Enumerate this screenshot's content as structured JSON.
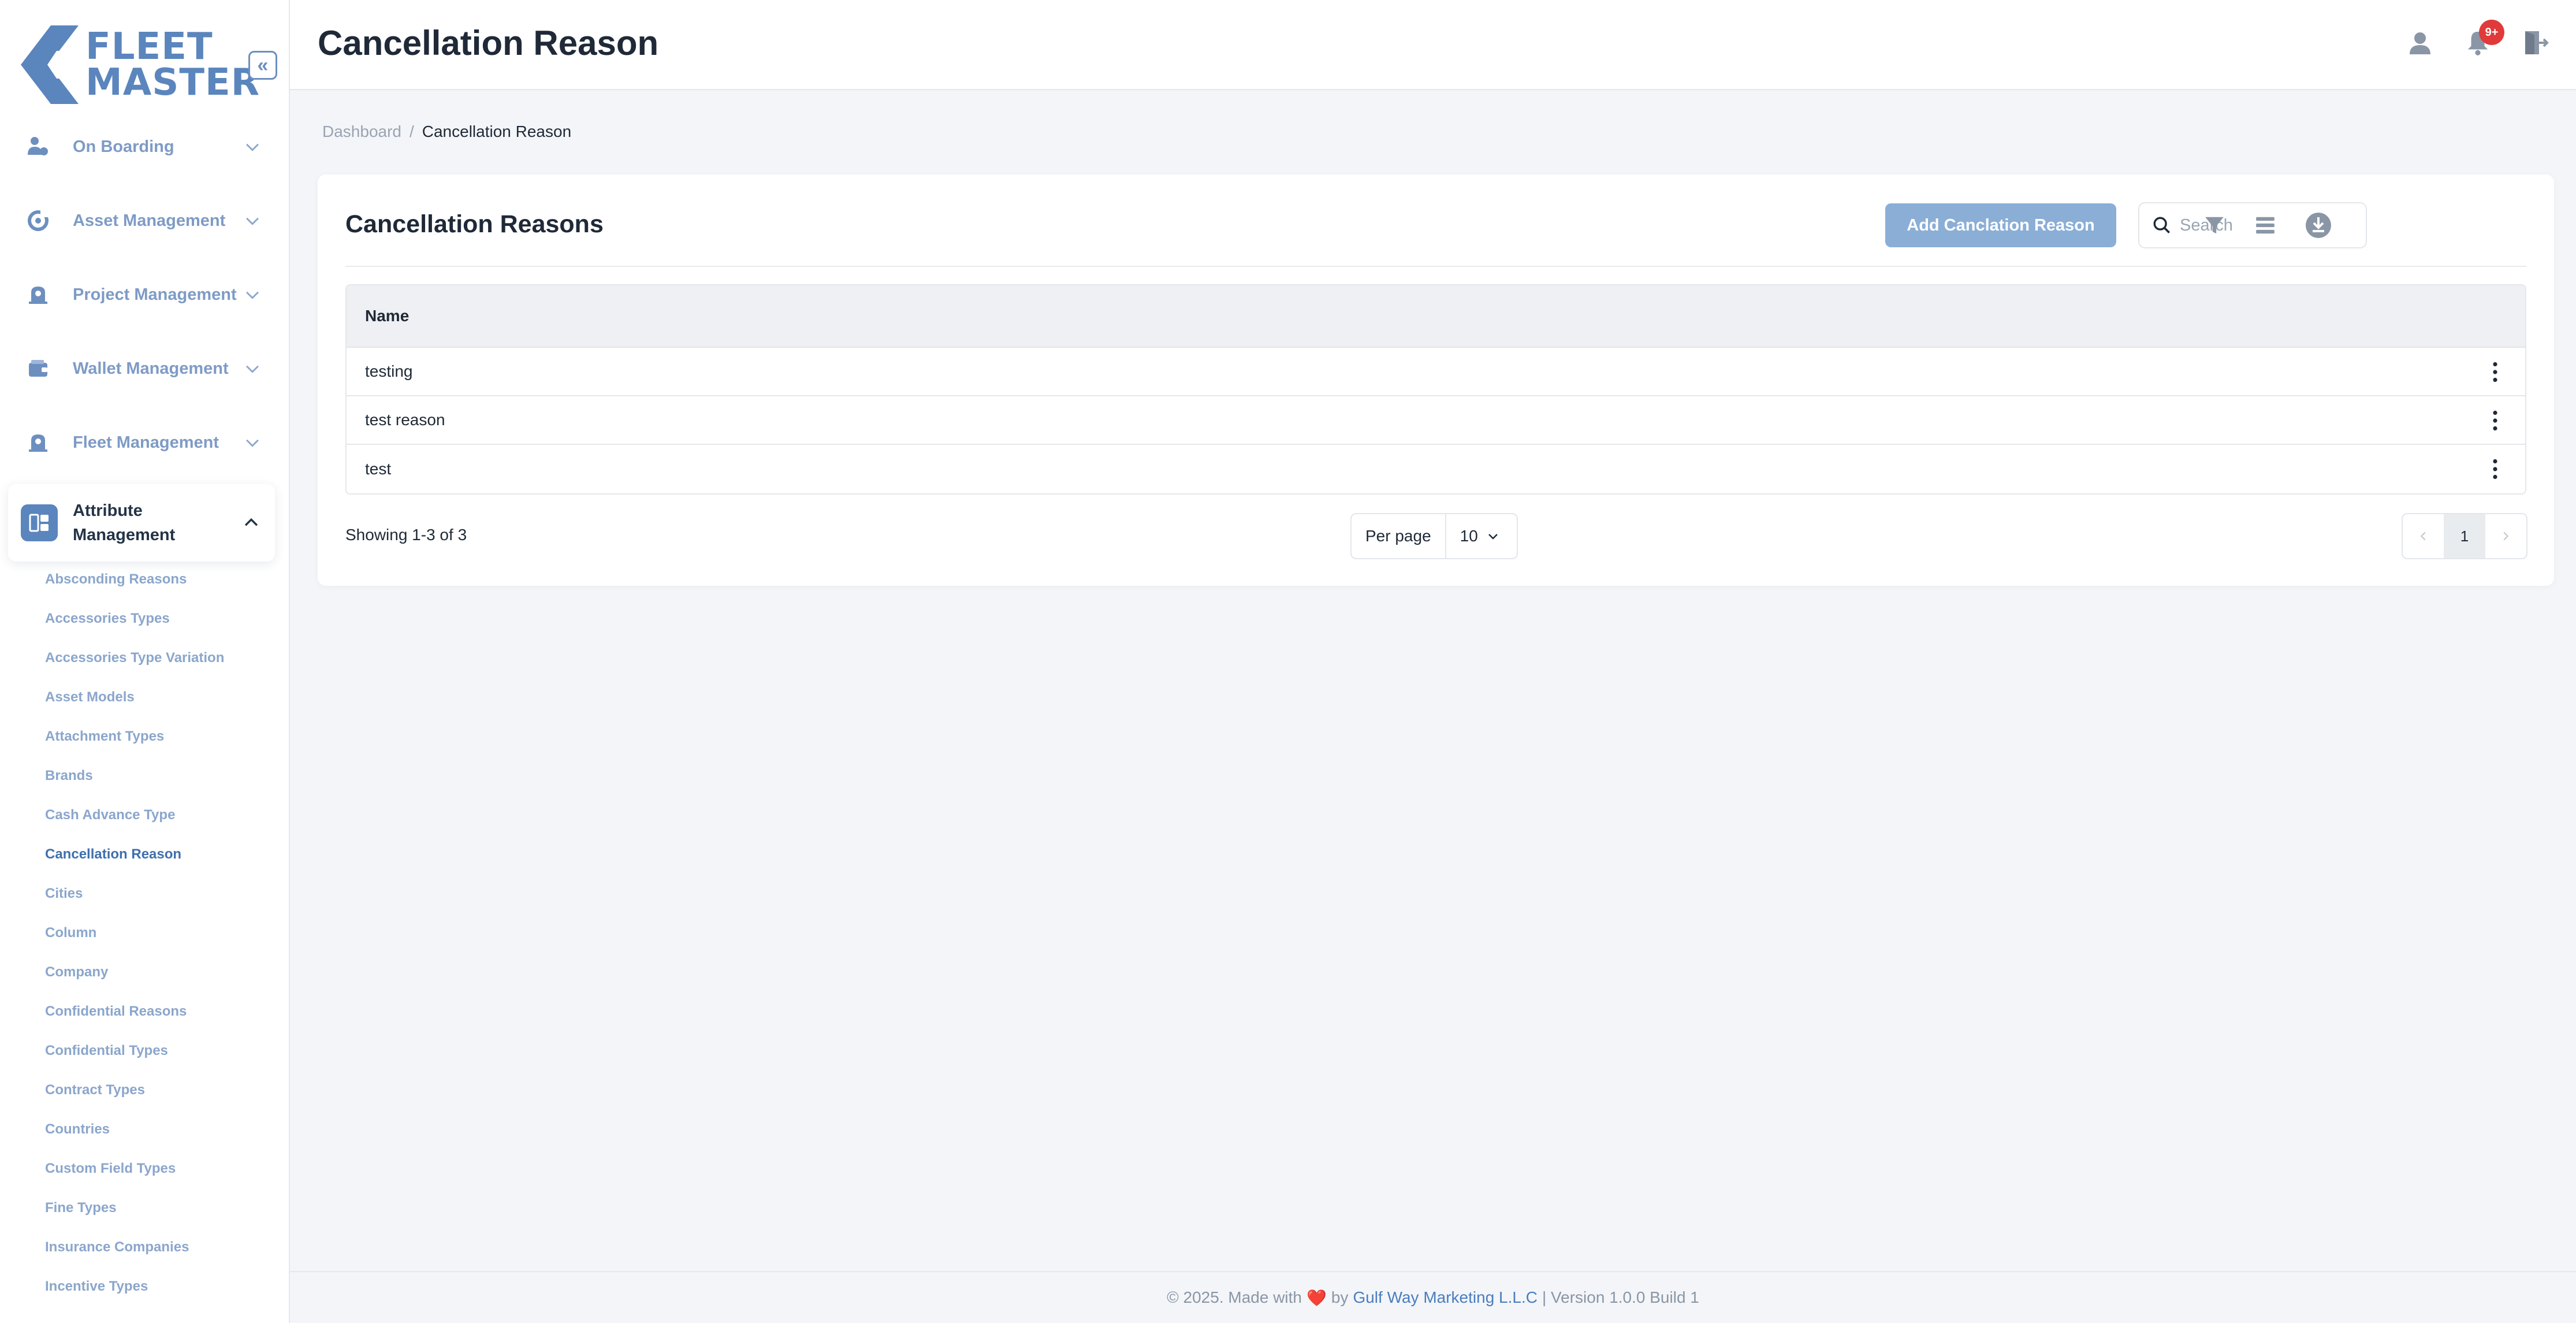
{
  "brand": {
    "line1": "FLEET",
    "line2": "MASTER",
    "color": "#5b85bd"
  },
  "sidebar": {
    "collapse_icon": "double-chevron-left-icon",
    "items": [
      {
        "label": "On Boarding",
        "icon": "onboarding-icon",
        "expanded": false
      },
      {
        "label": "Asset Management",
        "icon": "asset-icon",
        "expanded": false
      },
      {
        "label": "Project Management",
        "icon": "project-icon",
        "expanded": false
      },
      {
        "label": "Wallet Management",
        "icon": "wallet-icon",
        "expanded": false
      },
      {
        "label": "Fleet Management",
        "icon": "fleet-icon",
        "expanded": false
      },
      {
        "label_line1": "Attribute",
        "label_line2": "Management",
        "icon": "attribute-icon",
        "expanded": true
      }
    ],
    "subitems": [
      "Absconding Reasons",
      "Accessories Types",
      "Accessories Type Variation",
      "Asset Models",
      "Attachment Types",
      "Brands",
      "Cash Advance Type",
      "Cancellation Reason",
      "Cities",
      "Column",
      "Company",
      "Confidential Reasons",
      "Confidential Types",
      "Contract Types",
      "Countries",
      "Custom Field Types",
      "Fine Types",
      "Insurance Companies",
      "Incentive Types"
    ],
    "active_subitem": "Cancellation Reason"
  },
  "header": {
    "title": "Cancellation Reason",
    "notification_badge": "9+",
    "icons": [
      "user-icon",
      "bell-icon",
      "logout-icon"
    ]
  },
  "breadcrumb": {
    "home": "Dashboard",
    "separator": "/",
    "current": "Cancellation Reason"
  },
  "card": {
    "title": "Cancellation Reasons",
    "add_button": "Add Canclation Reason",
    "search_placeholder": "Search",
    "search_value": "",
    "tools": [
      "filter-icon",
      "columns-icon",
      "download-icon"
    ]
  },
  "table": {
    "columns": [
      "Name"
    ],
    "rows": [
      {
        "name": "testing"
      },
      {
        "name": "test reason"
      },
      {
        "name": "test"
      }
    ]
  },
  "pagination": {
    "showing": "Showing 1-3 of 3",
    "per_page_label": "Per page",
    "per_page_value": "10",
    "current_page": "1"
  },
  "footer": {
    "prefix": "© 2025. Made with",
    "heart": "❤️",
    "by": "by",
    "company": "Gulf Way Marketing L.L.C",
    "suffix": "| Version 1.0.0 Build 1"
  },
  "colors": {
    "accent": "#5b85bd",
    "button": "#8aaed6",
    "badge": "#e03a3a",
    "link": "#4a7dc0"
  }
}
